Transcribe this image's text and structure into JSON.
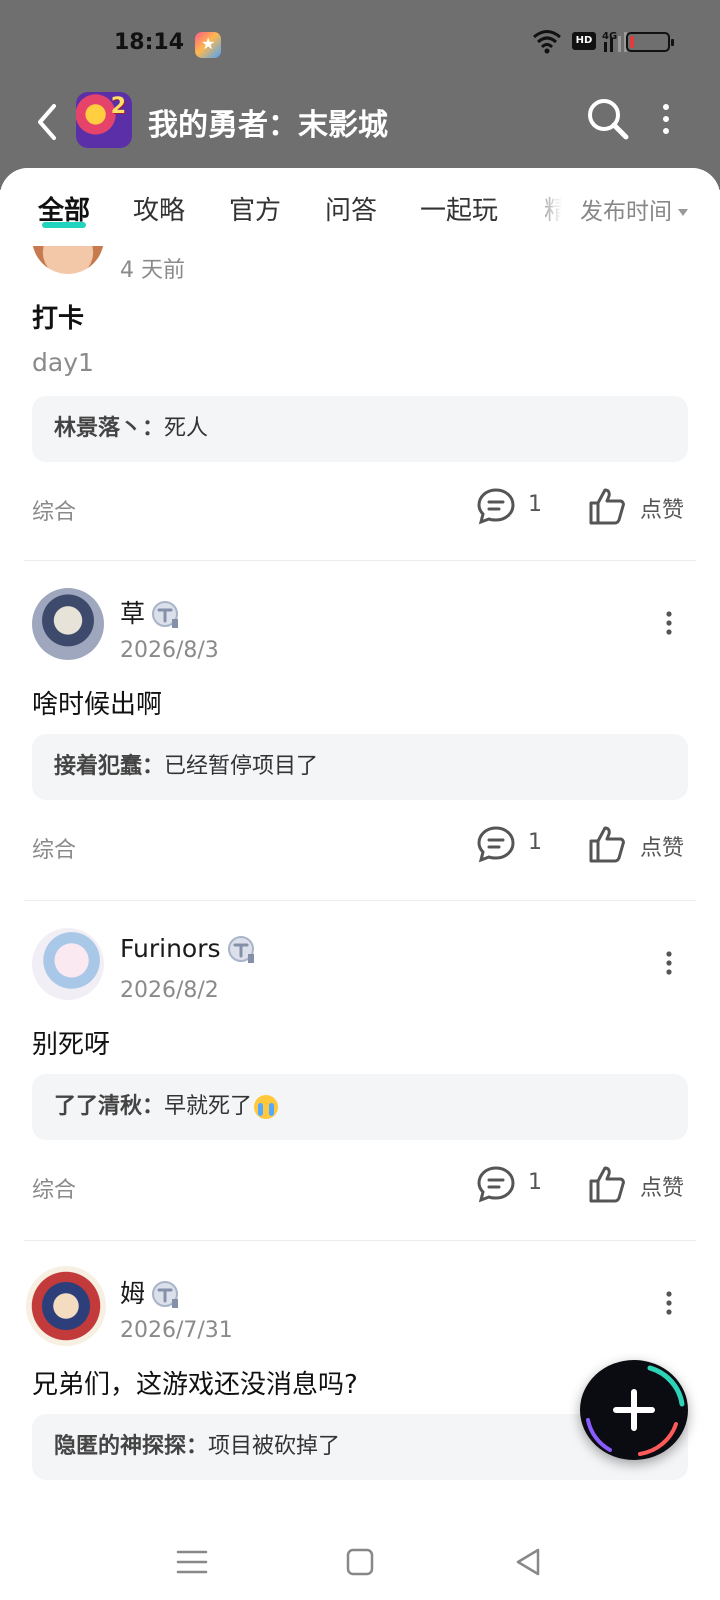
{
  "status_bar": {
    "time": "18:14",
    "hd_label": "HD",
    "network_label": "4G"
  },
  "header": {
    "title": "我的勇者：末影城",
    "back_icon": "chevron-left-icon",
    "search_icon": "search-icon",
    "more_icon": "more-vertical-icon"
  },
  "tabs": {
    "items": [
      {
        "label": "全部",
        "active": true
      },
      {
        "label": "攻略"
      },
      {
        "label": "官方"
      },
      {
        "label": "问答"
      },
      {
        "label": "一起玩"
      },
      {
        "label": "精"
      }
    ],
    "sort_label": "发布时间"
  },
  "colors": {
    "accent": "#21d4c0",
    "header_bg": "#6f6f6f",
    "reply_bg": "#f4f5f7"
  },
  "posts": [
    {
      "date": "4 天前",
      "title": "打卡",
      "body": "day1",
      "reply_user": "林景落丶：",
      "reply_text": "死人",
      "category": "综合",
      "comment_count": "1",
      "like_label": "点赞"
    },
    {
      "author": "草",
      "date": "2026/8/3",
      "title": "啥时候出啊",
      "reply_user": "接着犯蠢：",
      "reply_text": "已经暂停项目了",
      "category": "综合",
      "comment_count": "1",
      "like_label": "点赞"
    },
    {
      "author": "Furinors",
      "date": "2026/8/2",
      "title": "别死呀",
      "reply_user": "了了清秋：",
      "reply_text": "早就死了",
      "category": "综合",
      "comment_count": "1",
      "like_label": "点赞"
    },
    {
      "author": "姆",
      "date": "2026/7/31",
      "title": "兄弟们，这游戏还没消息吗?",
      "reply_user": "隐匿的神探探：",
      "reply_text": "项目被砍掉了"
    }
  ],
  "fab": {
    "icon": "plus-icon"
  },
  "system_nav": {
    "menu_icon": "menu-icon",
    "home_icon": "home-square-icon",
    "back_icon": "back-triangle-icon"
  }
}
